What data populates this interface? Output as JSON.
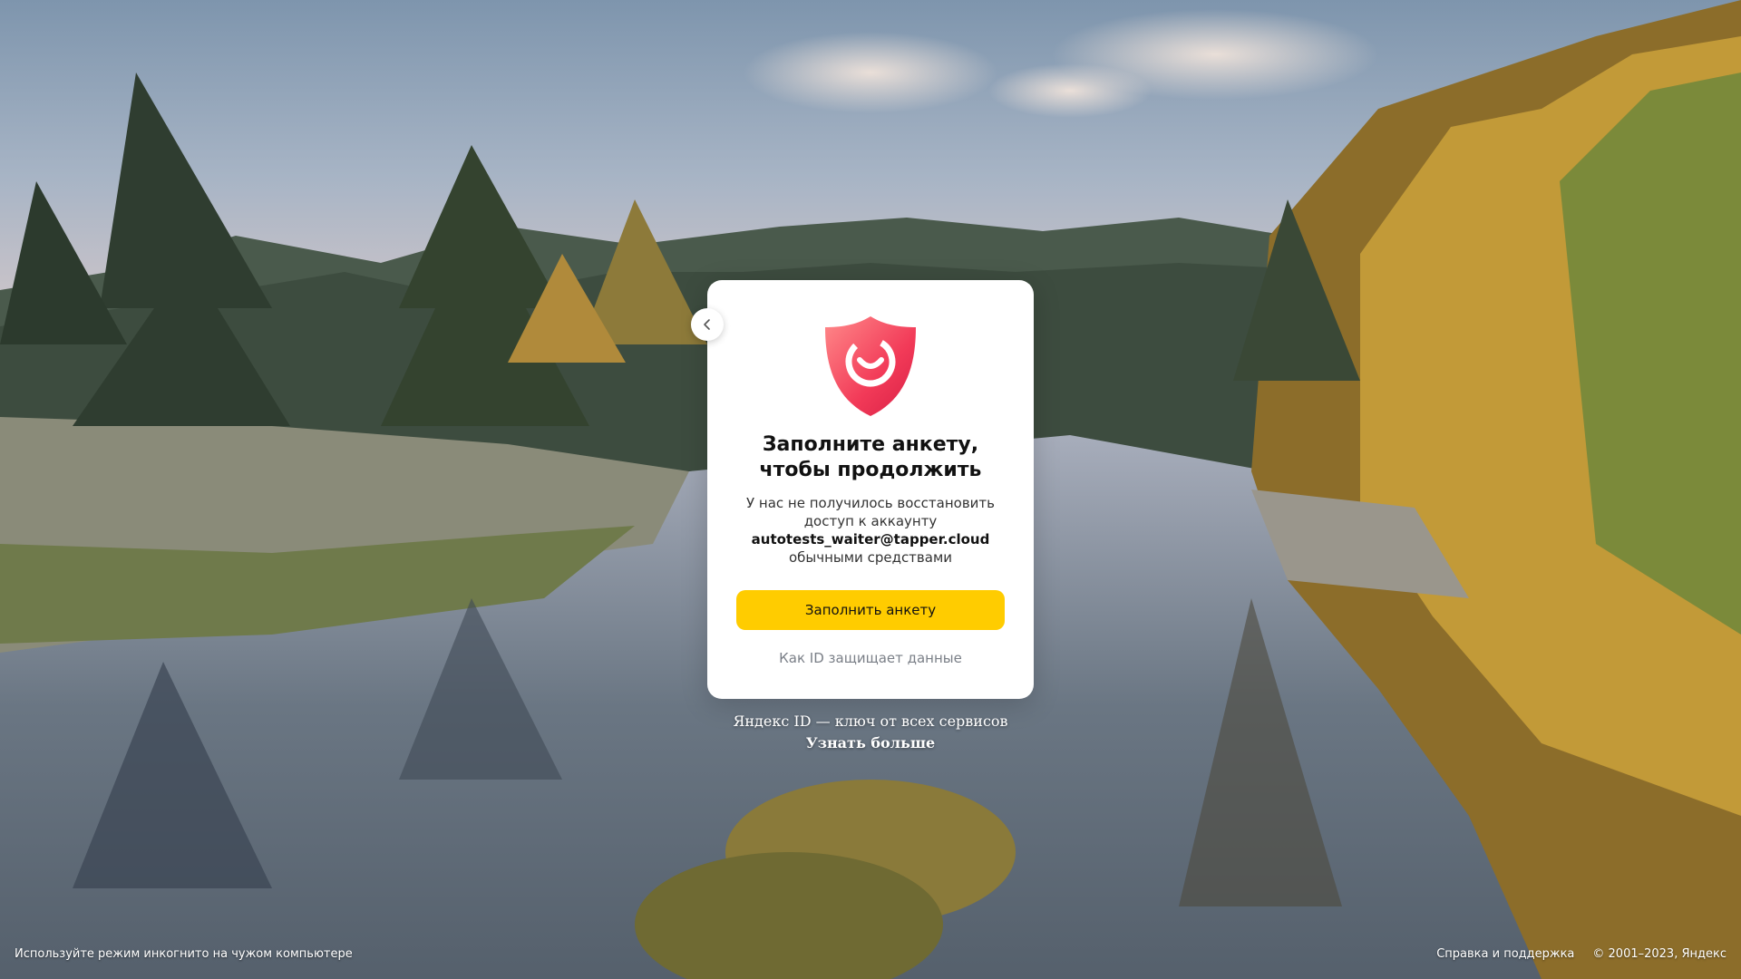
{
  "background": {
    "sky_top": "#7f98b3",
    "sky_mid": "#b8b8c6",
    "forest_dark": "#3a4a3a",
    "autumn": "#c79a2e",
    "water": "#6b7a88"
  },
  "card": {
    "back_icon": "chevron-left-icon",
    "shield_icon": "shield-smile-icon",
    "title": "Заполните анкету, чтобы продолжить",
    "desc_line1": "У нас не получилось восстановить",
    "desc_line2": "доступ к аккаунту",
    "login": "autotests_waiter@tapper.cloud",
    "desc_line3": "обычными средствами",
    "primary_button": "Заполнить анкету",
    "secondary_link": "Как ID защищает данные",
    "accent_color": "#ffcc00"
  },
  "promo": {
    "text": "Яндекс ID — ключ от всех сервисов",
    "link": "Узнать больше"
  },
  "footer": {
    "left": "Используйте режим инкогнито на чужом компьютере",
    "help": "Справка и поддержка",
    "copyright": "© 2001–2023, Яндекс"
  }
}
